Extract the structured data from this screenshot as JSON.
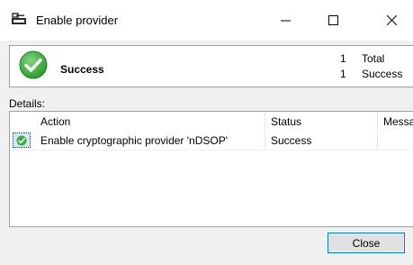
{
  "window": {
    "title": "Enable provider",
    "minimize_label": "—",
    "maximize_label": "☐",
    "close_label": "✕"
  },
  "summary": {
    "status": "Success",
    "total_count": "1",
    "total_label": "Total",
    "success_count": "1",
    "success_label": "Success"
  },
  "details": {
    "label": "Details:",
    "columns": [
      "Action",
      "Status",
      "Message"
    ],
    "rows": [
      {
        "action": "Enable cryptographic provider 'nDSOP'",
        "status": "Success",
        "message": ""
      }
    ]
  },
  "buttons": {
    "close": "Close"
  },
  "colors": {
    "success_green": "#3cab3c",
    "accent": "#0078d7"
  }
}
